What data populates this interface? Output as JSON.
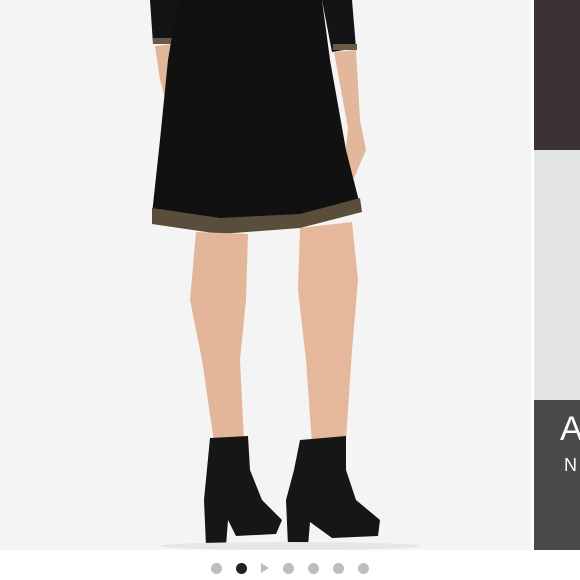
{
  "carousel": {
    "next_banner": {
      "line1": "A",
      "line2": "N"
    },
    "pager": {
      "count": 7,
      "active_index": 1,
      "video_index": 2
    }
  }
}
